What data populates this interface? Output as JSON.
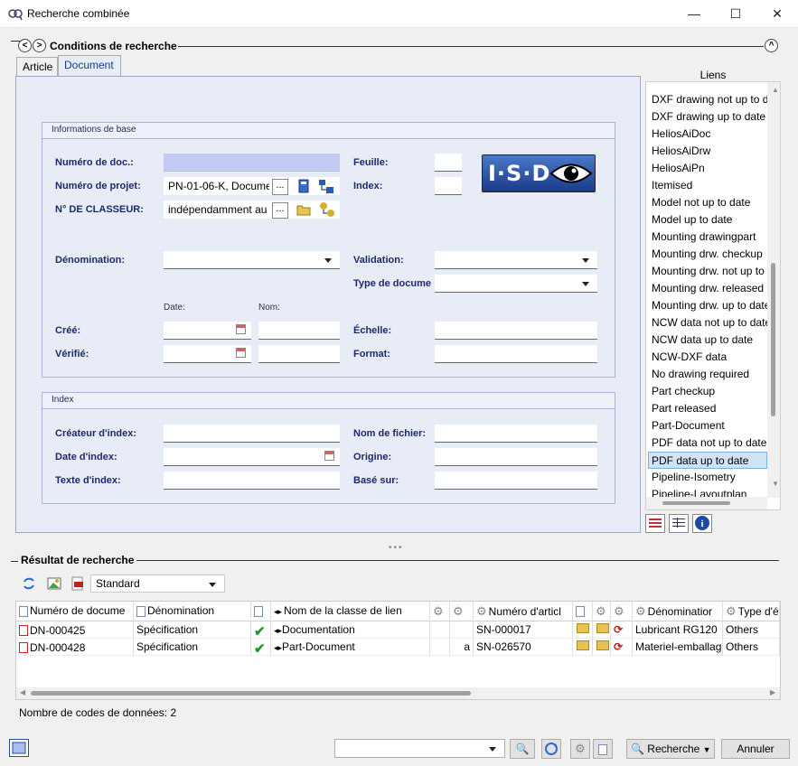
{
  "window": {
    "title": "Recherche combinée",
    "min": "—",
    "max": "☐",
    "close": "✕"
  },
  "conditions": {
    "title": "Conditions de recherche",
    "nav_prev": "<",
    "nav_next": ">",
    "collapse": "^"
  },
  "tabs": [
    {
      "label": "Article"
    },
    {
      "label": "Document"
    }
  ],
  "basic": {
    "title": "Informations de base",
    "numero_doc": {
      "label": "Numéro de doc.:",
      "value": ""
    },
    "numero_projet": {
      "label": "Numéro de projet:",
      "value": "PN-01-06-K, Docume"
    },
    "classeur": {
      "label": "N° DE CLASSEUR:",
      "value": "indépendamment au"
    },
    "feuille": {
      "label": "Feuille:",
      "value": ""
    },
    "index": {
      "label": "Index:",
      "value": ""
    },
    "logo_text": "I·S·D",
    "denomination": {
      "label": "Dénomination:",
      "value": ""
    },
    "validation": {
      "label": "Validation:",
      "value": ""
    },
    "type_doc": {
      "label": "Type de docume",
      "value": ""
    },
    "date_hdr": "Date:",
    "nom_hdr": "Nom:",
    "cree": {
      "label": "Créé:"
    },
    "verifie": {
      "label": "Vérifié:"
    },
    "echelle": {
      "label": "Échelle:"
    },
    "format": {
      "label": "Format:"
    },
    "ellipsis": "..."
  },
  "indexgrp": {
    "title": "Index",
    "createur": {
      "label": "Créateur d'index:"
    },
    "date": {
      "label": "Date d'index:"
    },
    "texte": {
      "label": "Texte d'index:"
    },
    "fichier": {
      "label": "Nom de fichier:"
    },
    "origine": {
      "label": "Origine:"
    },
    "base": {
      "label": "Basé sur:"
    }
  },
  "links": {
    "title": "Liens",
    "items": [
      "DXF drawing not up to date",
      "DXF drawing up to date",
      "HeliosAiDoc",
      "HeliosAiDrw",
      "HeliosAiPn",
      "Itemised",
      "Model not up to date",
      "Model up to date",
      "Mounting drawingpart",
      "Mounting drw. checkup",
      "Mounting drw. not up to date",
      "Mounting drw. released",
      "Mounting drw. up to date",
      "NCW data not up to date",
      "NCW data up to date",
      "NCW-DXF data",
      "No drawing required",
      "Part checkup",
      "Part released",
      "Part-Document",
      "PDF data not up to date",
      "PDF data up to date",
      "Pipeline-Isometry",
      "Pipeline-Layoutplan"
    ],
    "selected_index": 21
  },
  "results": {
    "title": "Résultat de recherche",
    "view": "Standard",
    "columns": [
      "Numéro de docume",
      "Dénomination",
      "",
      "Nom de la classe de lien",
      "",
      "",
      "Numéro d'articl",
      "",
      "",
      "",
      "Dénominatior",
      "Type d'é"
    ],
    "rows": [
      [
        "DN-000425",
        "Spécification",
        "✔",
        "Documentation",
        "",
        "",
        "SN-000017",
        "",
        "",
        "",
        "Lubricant RG120",
        "Others"
      ],
      [
        "DN-000428",
        "Spécification",
        "✔",
        "Part-Document",
        "",
        "a",
        "SN-026570",
        "",
        "",
        "",
        "Materiel-emballag",
        "Others"
      ]
    ],
    "count_text": "Nombre de codes de données: 2"
  },
  "footer": {
    "search": "Recherche",
    "cancel": "Annuler",
    "combo": ""
  },
  "colors": {
    "panel": "#e8ecf7",
    "label": "#1a2a6a",
    "selected_field": "#c4cbf2",
    "link_selected": "#cfe4f7"
  }
}
